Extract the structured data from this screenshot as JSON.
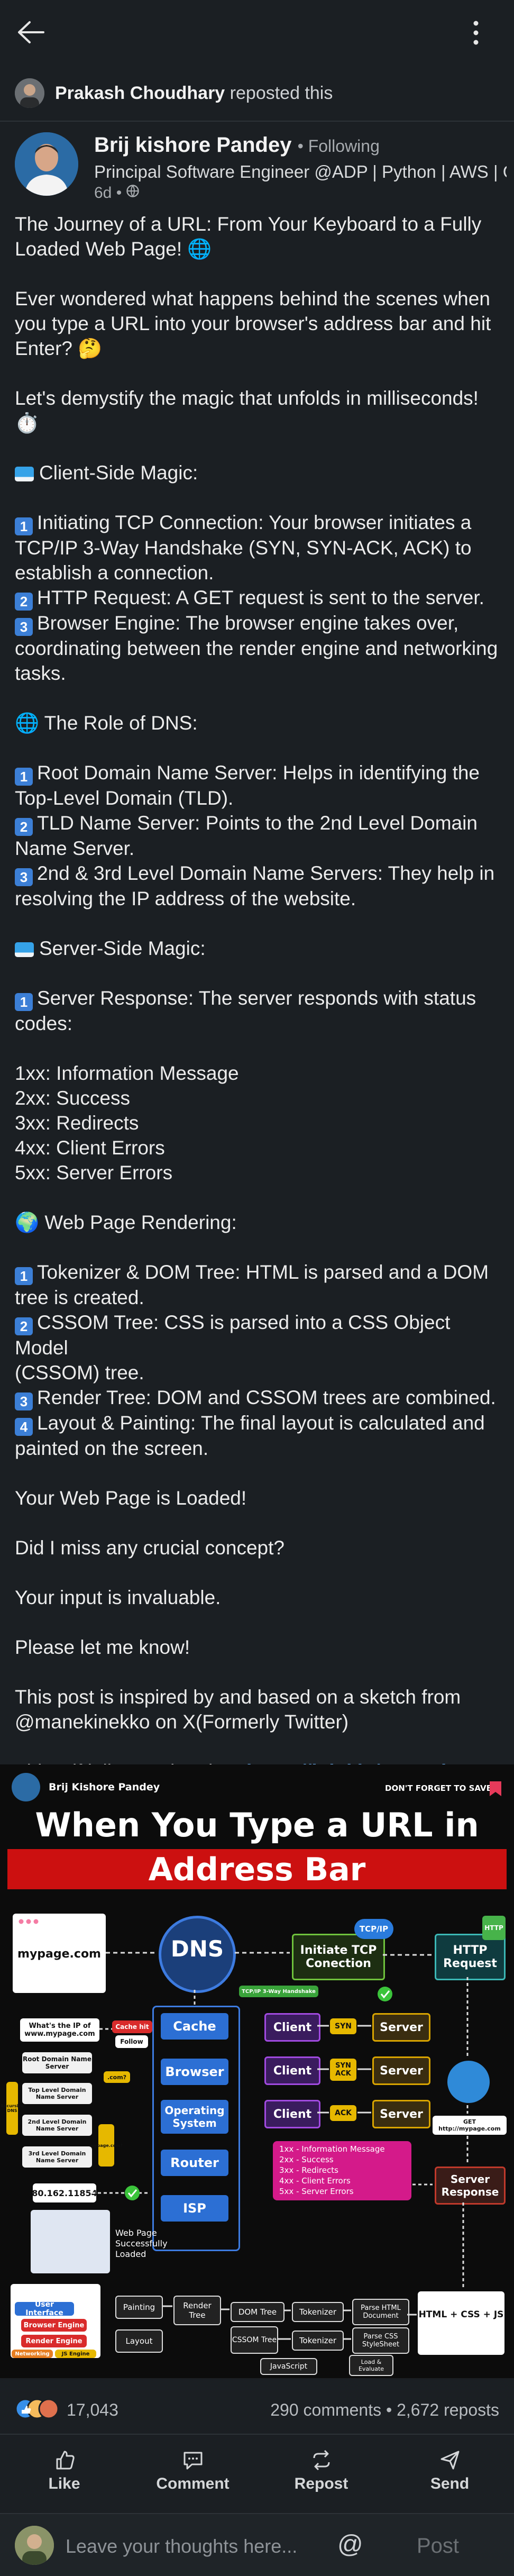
{
  "post": {
    "reposter_name": "Prakash Choudhary",
    "reposted_text": "reposted this",
    "author_name": "Brij kishore Pandey",
    "following": "• Following",
    "headline": "Principal Software Engineer @ADP | Python | AWS | Go ...",
    "time": "6d •",
    "lines": [
      "The Journey of a URL: From Your Keyboard to a Fully",
      "Loaded Web Page! 🌐",
      "",
      "Ever wondered what happens behind the scenes when",
      "you type a URL into your browser's address bar and hit",
      "Enter? 🤔",
      "",
      "Let's demystify the magic that unfolds in milliseconds!",
      "⏱️",
      "",
      "Client-Side Magic:",
      "",
      "Initiating TCP Connection: Your browser initiates a",
      "TCP/IP 3-Way Handshake (SYN, SYN-ACK, ACK) to",
      "establish a connection.",
      "HTTP Request: A GET request is sent to the server.",
      "Browser Engine: The browser engine takes over,",
      "coordinating between the render engine and networking",
      "tasks.",
      "",
      "🌐 The Role of DNS:",
      "",
      "Root Domain Name Server: Helps in identifying the",
      "Top-Level Domain (TLD).",
      "TLD Name Server: Points to the 2nd Level Domain",
      "Name Server.",
      "2nd & 3rd Level Domain Name Servers: They help in",
      "resolving the IP address of the website.",
      "",
      "Server-Side Magic:",
      "",
      "Server Response: The server responds with status",
      "codes:",
      "",
      "1xx: Information Message",
      "2xx: Success",
      "3xx: Redirects",
      "4xx: Client Errors",
      "5xx: Server Errors",
      "",
      "🌍 Web Page Rendering:",
      "",
      "Tokenizer & DOM Tree: HTML is parsed and a DOM",
      "tree is created.",
      "CSSOM Tree: CSS is parsed into a CSS Object Model",
      "(CSSOM) tree.",
      "Render Tree: DOM and CSSOM trees are combined.",
      "Layout & Painting: The final layout is calculated and",
      "painted on the screen.",
      "",
      "Your Web Page is Loaded!",
      "",
      "Did I miss any crucial concept?",
      "",
      "Your input is invaluable.",
      "",
      "Please let me know!",
      "",
      "This post is inspired by and based on a sketch from",
      "@manekinekko on X(Formerly Twitter)",
      "",
      "This Gif it licensed under : "
    ],
    "markers": {
      "12": "1",
      "15": "2",
      "16": "3",
      "22": "1",
      "24": "2",
      "26": "3",
      "31": "1",
      "42": "1",
      "44": "2",
      "46": "3",
      "47": "4"
    },
    "flags": {
      "10": true,
      "29": true
    },
    "link": "https://lnkd.in/eBAGdRtG"
  },
  "infographic": {
    "author": "Brij Kishore Pandey",
    "save": "DON'T FORGET TO SAVE",
    "title1": "When You Type a URL in",
    "title2": "Address Bar",
    "url": "mypage.com",
    "dns": "DNS",
    "tcp_ip": "TCP/IP",
    "tcp_box": "Initiate TCP Conection",
    "http_box": "HTTP Request",
    "http_badge": "HTTP",
    "client_stack": [
      "Cache",
      "Browser",
      "Operating System",
      "Router",
      "ISP"
    ],
    "cache_hit": "Cache hit",
    "follow": "Follow",
    "handshake_note": "TCP/IP 3-Way Handshake",
    "clients": [
      "Client",
      "Client",
      "Client"
    ],
    "servers": [
      "Server",
      "Server",
      "Server"
    ],
    "signals": [
      "SYN",
      "SYN ACK",
      "ACK"
    ],
    "what_ip": "What's the IP of www.mypage.com",
    "root": "Root Domain Name Server",
    "tld": "Top Level Domain Name Server",
    "second": "2nd Level Domain Name Server",
    "third": "3rd Level Domain Name Server",
    "com": ".com?",
    "mypage_q": "mypage.com?",
    "recursive": "Recursive DNS",
    "ip": "80.162.11854",
    "get": "GET http://mypage.com",
    "status_lines": [
      "1xx - Information Message",
      "2xx - Success",
      "3xx - Redirects",
      "4xx - Client Errors",
      "5xx - Server Errors"
    ],
    "server_response": "Server Response",
    "loaded": "Web Page Successfully Loaded",
    "ui": "User Interface",
    "browser_engine": "Browser Engine",
    "render_engine": "Render Engine",
    "networking": "Networking",
    "js_engine": "JS Engine",
    "painting": "Painting",
    "layout": "Layout",
    "render_tree": "Render Tree",
    "dom_tree": "DOM Tree",
    "cssom_tree": "CSSOM Tree",
    "tokenizer1": "Tokenizer",
    "tokenizer2": "Tokenizer",
    "parse_html": "Parse HTML Document",
    "parse_css": "Parse CSS StyleSheet",
    "javascript": "JavaScript",
    "load_eval": "Load & Evaluate",
    "html_css_js": "HTML + CSS + JS"
  },
  "social": {
    "reactions": "17,043",
    "comments_reposts": "290 comments • 2,672 reposts"
  },
  "actions": [
    "Like",
    "Comment",
    "Repost",
    "Send"
  ],
  "comment_bar": {
    "placeholder": "Leave your thoughts here...",
    "at": "@",
    "post": "Post"
  },
  "colors": {
    "background": "#1b1f23",
    "link": "#70b5f9",
    "num_badge": "#3c7fd6",
    "title_red": "#cc1010"
  }
}
